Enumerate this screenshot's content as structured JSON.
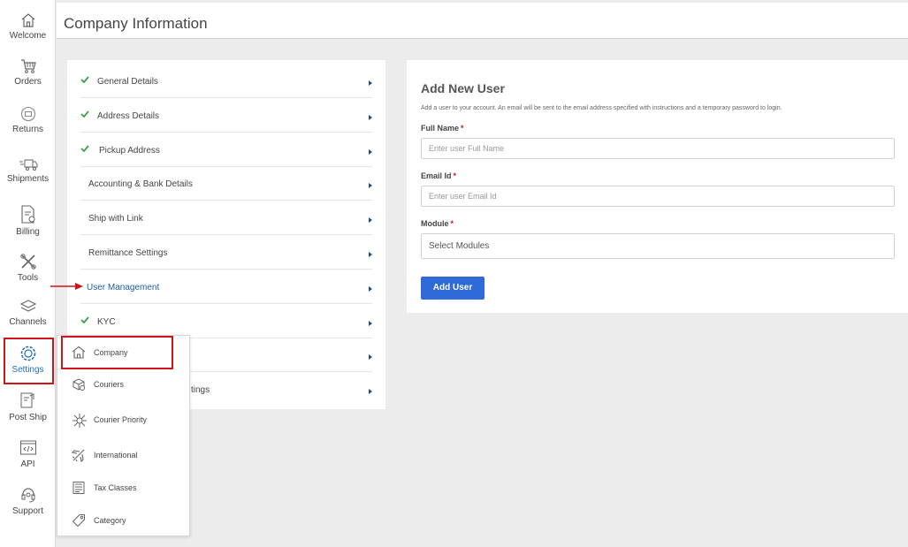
{
  "sidebar": {
    "items": [
      {
        "label": "Welcome",
        "icon": "home-icon"
      },
      {
        "label": "Orders",
        "icon": "cart-icon"
      },
      {
        "label": "Returns",
        "icon": "returns-icon"
      },
      {
        "label": "Shipments",
        "icon": "truck-icon"
      },
      {
        "label": "Billing",
        "icon": "bill-icon"
      },
      {
        "label": "Tools",
        "icon": "tools-icon"
      },
      {
        "label": "Channels",
        "icon": "layers-icon"
      },
      {
        "label": "Settings",
        "icon": "gear-icon"
      },
      {
        "label": "Post Ship",
        "icon": "post-ship-icon"
      },
      {
        "label": "API",
        "icon": "code-icon"
      },
      {
        "label": "Support",
        "icon": "headset-icon"
      }
    ]
  },
  "header": {
    "title": "Company Information"
  },
  "menu": {
    "items": [
      {
        "label": "General Details",
        "checked": true
      },
      {
        "label": "Address Details",
        "checked": true
      },
      {
        "label": "Pickup Address",
        "checked": true
      },
      {
        "label": "Accounting & Bank Details",
        "checked": false
      },
      {
        "label": "Ship with Link",
        "checked": false
      },
      {
        "label": "Remittance Settings",
        "checked": false
      },
      {
        "label": "User Management",
        "checked": false
      },
      {
        "label": "KYC",
        "checked": true
      },
      {
        "label": "",
        "checked": false
      },
      {
        "label": "tings",
        "checked": false
      }
    ]
  },
  "form": {
    "title": "Add New User",
    "subtitle": "Add a user to your account. An email will be sent to the email address specified with instructions and a temporary password to login.",
    "full_name_label": "Full Name",
    "full_name_placeholder": "Enter user Full Name",
    "email_label": "Email Id",
    "email_placeholder": "Enter user Email Id",
    "module_label": "Module",
    "module_placeholder": "Select Modules",
    "required_mark": "*",
    "submit_label": "Add User"
  },
  "popup": {
    "items": [
      {
        "label": "Company",
        "icon": "home-icon"
      },
      {
        "label": "Couriers",
        "icon": "courier-box-icon"
      },
      {
        "label": "Courier Priority",
        "icon": "network-icon"
      },
      {
        "label": "International",
        "icon": "airplane-icon"
      },
      {
        "label": "Tax Classes",
        "icon": "document-icon"
      },
      {
        "label": "Category",
        "icon": "tag-icon"
      }
    ]
  },
  "colors": {
    "accent": "#2f6ad9",
    "highlight": "#d0141b",
    "check": "#3aa04a"
  }
}
